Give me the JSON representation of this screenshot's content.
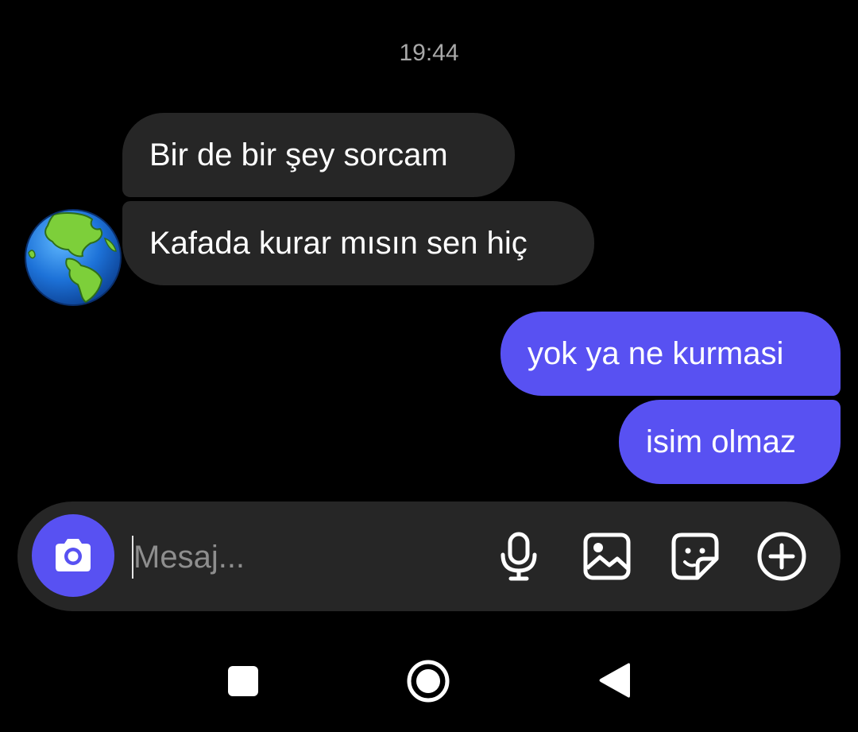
{
  "thread": {
    "timestamp": "19:44",
    "contact_avatar_icon": "earth-globe-americas-icon",
    "messages": [
      {
        "direction": "incoming",
        "text": "Bir de bir şey sorcam"
      },
      {
        "direction": "incoming",
        "text": "Kafada kurar mısın sen hiç"
      },
      {
        "direction": "outgoing",
        "text": "yok ya ne kurmasi"
      },
      {
        "direction": "outgoing",
        "text": "isim olmaz"
      }
    ]
  },
  "composer": {
    "placeholder": "Mesaj...",
    "value": "",
    "icons": [
      "camera-icon",
      "microphone-icon",
      "gallery-icon",
      "sticker-icon",
      "add-icon"
    ]
  },
  "navbar": {
    "icons": [
      "recents-icon",
      "home-icon",
      "back-icon"
    ]
  },
  "colors": {
    "background": "#000000",
    "incoming_bubble": "#262626",
    "outgoing_bubble": "#5851f2",
    "timestamp": "#a8a8a8",
    "placeholder": "#8e8e8e"
  }
}
